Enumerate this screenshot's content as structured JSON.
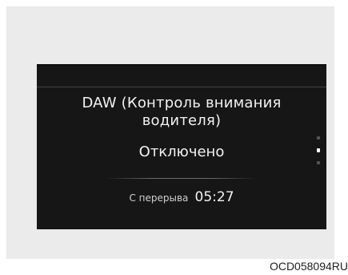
{
  "display": {
    "title_line1": "DAW (Контроль внимания",
    "title_line2": "водителя)",
    "status": "Отключено",
    "break_label": "С перерыва",
    "break_time": "05:27",
    "page_indicator": {
      "pages": 3,
      "active_index": 1
    }
  },
  "figure_code": "OCD058094RU",
  "colors": {
    "screen_background": "#161616",
    "text": "#f2f2f2",
    "panel_background": "#ebebeb"
  }
}
